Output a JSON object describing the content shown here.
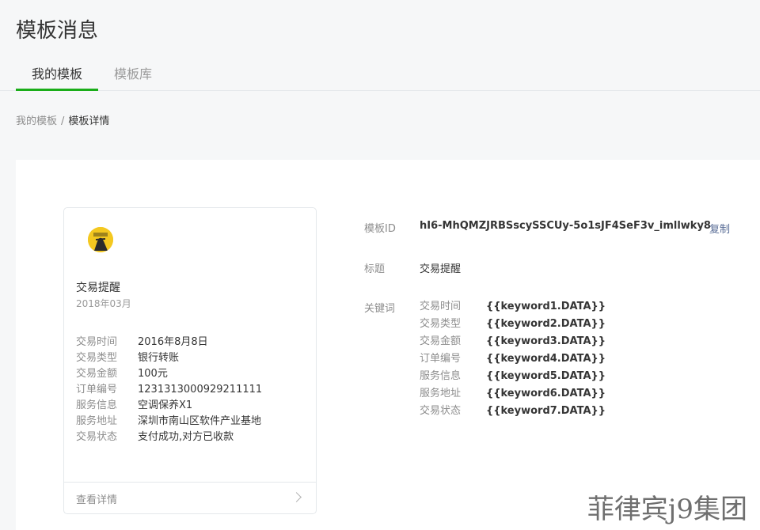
{
  "page_title": "模板消息",
  "tabs": [
    {
      "label": "我的模板"
    },
    {
      "label": "模板库"
    }
  ],
  "breadcrumb": {
    "parent": "我的模板",
    "separator": "/",
    "current": "模板详情"
  },
  "preview": {
    "title": "交易提醒",
    "date": "2018年03月",
    "fields": [
      {
        "label": "交易时间",
        "value": "2016年8月8日"
      },
      {
        "label": "交易类型",
        "value": "银行转账"
      },
      {
        "label": "交易金额",
        "value": "100元"
      },
      {
        "label": "订单编号",
        "value": "1231313000929211111"
      },
      {
        "label": "服务信息",
        "value": "空调保养X1"
      },
      {
        "label": "服务地址",
        "value": "深圳市南山区软件产业基地"
      },
      {
        "label": "交易状态",
        "value": "支付成功,对方已收款"
      }
    ],
    "footer_label": "查看详情"
  },
  "info": {
    "id_label": "模板ID",
    "id_value": "hI6-MhQMZJRBSscySSCUy-5o1sJF4SeF3v_imllwky8",
    "copy_label": "复制",
    "title_label": "标题",
    "title_value": "交易提醒",
    "keywords_label": "关键词",
    "keywords": [
      {
        "name": "交易时间",
        "value": "{{keyword1.DATA}}"
      },
      {
        "name": "交易类型",
        "value": "{{keyword2.DATA}}"
      },
      {
        "name": "交易金额",
        "value": "{{keyword3.DATA}}"
      },
      {
        "name": "订单编号",
        "value": "{{keyword4.DATA}}"
      },
      {
        "name": "服务信息",
        "value": "{{keyword5.DATA}}"
      },
      {
        "name": "服务地址",
        "value": "{{keyword6.DATA}}"
      },
      {
        "name": "交易状态",
        "value": "{{keyword7.DATA}}"
      }
    ]
  },
  "watermark": "菲律宾j9集团",
  "colors": {
    "accent": "#1aad19",
    "link": "#576b95",
    "avatar_bg": "#f4c820"
  }
}
